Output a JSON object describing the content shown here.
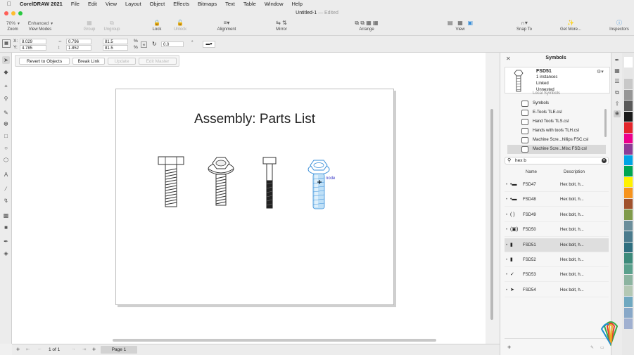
{
  "menubar": {
    "app": "CorelDRAW 2021",
    "items": [
      "File",
      "Edit",
      "View",
      "Layout",
      "Object",
      "Effects",
      "Bitmaps",
      "Text",
      "Table",
      "Window",
      "Help"
    ]
  },
  "window": {
    "title": "Untitled-1",
    "edited": "— Edited"
  },
  "toolbar": {
    "zoom_value": "70%",
    "zoom_label": "Zoom",
    "viewmode_value": "Enhanced",
    "viewmode_label": "View Modes",
    "group": "Group",
    "ungroup": "Ungroup",
    "lock": "Lock",
    "unlock": "Unlock",
    "alignment": "Alignment",
    "mirror": "Mirror",
    "arrange": "Arrange",
    "view": "View",
    "snap_to": "Snap To",
    "get_more": "Get More...",
    "inspectors": "Inspectors"
  },
  "propbar": {
    "x_label": "X:",
    "x_value": "8.029",
    "y_label": "Y:",
    "y_value": "4.785",
    "w_value": "0.796",
    "h_value": "1.852",
    "sx_value": "81.5",
    "sy_value": "81.5",
    "percent": "%",
    "angle_value": "0.0",
    "degree": "°"
  },
  "symbar": {
    "revert": "Revert to Objects",
    "break_link": "Break Link",
    "update": "Update",
    "edit_master": "Edit Master"
  },
  "page": {
    "title": "Assembly: Parts List",
    "node_label": "node"
  },
  "status": {
    "page_of": "1 of 1",
    "page_tab": "Page 1"
  },
  "docker": {
    "title": "Symbols",
    "preview": {
      "name": "FSD51",
      "instances": "1 instances",
      "linked": "Linked",
      "unnested": "Unnested"
    },
    "libraries": [
      {
        "name": "Local Symbols"
      },
      {
        "name": "Symbols"
      },
      {
        "name": "E-Tools TLE.csl"
      },
      {
        "name": "Hand Tools TLS.csl"
      },
      {
        "name": "Hands with tools TLH.csl"
      },
      {
        "name": "Machine Scre...hillips FSC.csl"
      },
      {
        "name": "Machine Scre...Misc FSD.csl"
      }
    ],
    "search_value": "hex b",
    "col_name": "Name",
    "col_desc": "Description",
    "rows": [
      {
        "name": "FSD47",
        "desc": "Hex bolt, h..."
      },
      {
        "name": "FSD48",
        "desc": "Hex bolt, h..."
      },
      {
        "name": "FSD49",
        "desc": "Hex bolt, h..."
      },
      {
        "name": "FSD50",
        "desc": "Hex bolt, h..."
      },
      {
        "name": "FSD51",
        "desc": "Hex bolt, h..."
      },
      {
        "name": "FSD52",
        "desc": "Hex bolt, h..."
      },
      {
        "name": "FSD53",
        "desc": "Hex bolt, h..."
      },
      {
        "name": "FSD54",
        "desc": "Hex bolt, h..."
      }
    ]
  },
  "colors": {
    "selection": "#3a8fd9",
    "palette": [
      "#ffffff",
      "#e6e6e6",
      "#c8c8c8",
      "#969696",
      "#5a5a5a",
      "#1a1a1a",
      "#e3262c",
      "#ec008c",
      "#8c3c96",
      "#00a4e4",
      "#00a651",
      "#fff200",
      "#f7941d",
      "#a0522d",
      "#7f9a4a",
      "#6b8e9b",
      "#4a7a8c",
      "#2f6f7f",
      "#3c8a7a",
      "#5aa08c",
      "#8cb4a0",
      "#b4c8b4",
      "#6fa8c0",
      "#88a8c8",
      "#a0b0d0"
    ]
  }
}
